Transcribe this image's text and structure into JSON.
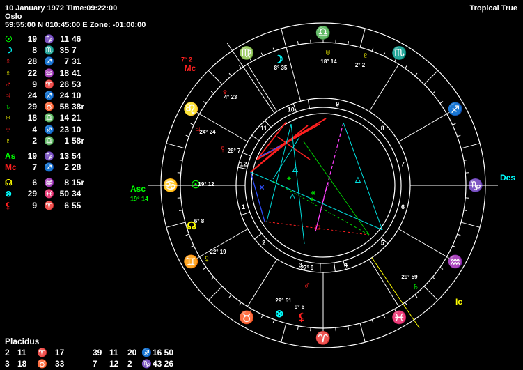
{
  "header": {
    "date_time": "10 January 1972 Time:09:22:00",
    "place": "Oslo",
    "coords": "59:55:00 N 010:45:00 E Zone: -01:00:00",
    "mode": "Tropical True"
  },
  "colors": {
    "fire": "#ff2020",
    "earth": "#00ff00",
    "air": "#ffff00",
    "water": "#00ffff",
    "white": "#ffffff",
    "blue": "#3050ff",
    "magenta": "#ff40ff",
    "cyan": "#00e0e0",
    "green": "#00d000"
  },
  "planets": [
    {
      "name": "Sun",
      "glyph": "☉",
      "color": "#00ff00",
      "deg": "19",
      "sign": "♑",
      "sign_color": "#00ff00",
      "min": "11",
      "sec": "46"
    },
    {
      "name": "Moon",
      "glyph": "☽",
      "color": "#00ffff",
      "deg": "8",
      "sign": "♏",
      "sign_color": "#00ffff",
      "min": "35",
      "sec": "7"
    },
    {
      "name": "Mercury",
      "glyph": "☿",
      "color": "#ff2020",
      "deg": "28",
      "sign": "♐",
      "sign_color": "#ff2020",
      "min": "7",
      "sec": "31"
    },
    {
      "name": "Venus",
      "glyph": "♀",
      "color": "#ffff00",
      "deg": "22",
      "sign": "♒",
      "sign_color": "#ffff00",
      "min": "18",
      "sec": "41"
    },
    {
      "name": "Mars",
      "glyph": "♂",
      "color": "#ff2020",
      "deg": "9",
      "sign": "♈",
      "sign_color": "#ff2020",
      "min": "26",
      "sec": "53"
    },
    {
      "name": "Jupiter",
      "glyph": "♃",
      "color": "#ff2020",
      "deg": "24",
      "sign": "♐",
      "sign_color": "#ff2020",
      "min": "24",
      "sec": "10"
    },
    {
      "name": "Saturn",
      "glyph": "♄",
      "color": "#00ff00",
      "deg": "29",
      "sign": "♉",
      "sign_color": "#00ff00",
      "min": "58",
      "sec": "38r"
    },
    {
      "name": "Uranus",
      "glyph": "♅",
      "color": "#ffff00",
      "deg": "18",
      "sign": "♎",
      "sign_color": "#ffff00",
      "min": "14",
      "sec": "21"
    },
    {
      "name": "Neptune",
      "glyph": "♆",
      "color": "#ff2020",
      "deg": "4",
      "sign": "♐",
      "sign_color": "#ff2020",
      "min": "23",
      "sec": "10"
    },
    {
      "name": "Pluto",
      "glyph": "♇",
      "color": "#ffff00",
      "deg": "2",
      "sign": "♎",
      "sign_color": "#ffff00",
      "min": "1",
      "sec": "58r"
    }
  ],
  "angles": [
    {
      "name": "As",
      "glyph": "As",
      "color": "#00ff00",
      "deg": "19",
      "sign": "♑",
      "sign_color": "#00ff00",
      "min": "13",
      "sec": "54"
    },
    {
      "name": "Mc",
      "glyph": "Mc",
      "color": "#ff2020",
      "deg": "7",
      "sign": "♐",
      "sign_color": "#ff2020",
      "min": "2",
      "sec": "28"
    }
  ],
  "points": [
    {
      "name": "Node",
      "glyph": "☊",
      "color": "#ffff00",
      "deg": "6",
      "sign": "♒",
      "sign_color": "#ffff00",
      "min": "8",
      "sec": "15r"
    },
    {
      "name": "Fortune",
      "glyph": "⊗",
      "color": "#00ffff",
      "deg": "29",
      "sign": "♓",
      "sign_color": "#00ffff",
      "min": "50",
      "sec": "34"
    },
    {
      "name": "Lilith",
      "glyph": "⚸",
      "color": "#ff2020",
      "deg": "9",
      "sign": "♈",
      "sign_color": "#ff2020",
      "min": "6",
      "sec": "55"
    }
  ],
  "house_system": "Placidus",
  "house_cusps": [
    [
      {
        "house": "2",
        "deg": "11",
        "sign": "♈",
        "sign_color": "#ff2020",
        "min": "17"
      },
      {
        "house": "3",
        "deg": "18",
        "sign": "♉",
        "sign_color": "#00ff00",
        "min": "33"
      }
    ],
    [
      {
        "house": "",
        "deg": "39",
        "sign": "",
        "sign_color": "#ffffff",
        "min": "11"
      },
      {
        "house": "",
        "deg": "7",
        "sign": "",
        "sign_color": "#ffffff",
        "min": "12"
      }
    ],
    [
      {
        "house": "",
        "deg": "20",
        "sign": "♐",
        "sign_color": "#ff2020",
        "min": "16 50"
      },
      {
        "house": "",
        "deg": "2",
        "sign": "♑",
        "sign_color": "#00ff00",
        "min": "43 26"
      }
    ]
  ],
  "wheel": {
    "zodiac_signs": [
      {
        "sign": "♎",
        "color": "#ffff00"
      },
      {
        "sign": "♏",
        "color": "#00ffff"
      },
      {
        "sign": "♐",
        "color": "#ff2020"
      },
      {
        "sign": "♑",
        "color": "#00ff00"
      },
      {
        "sign": "♒",
        "color": "#ffff00"
      },
      {
        "sign": "♓",
        "color": "#00ffff"
      },
      {
        "sign": "♈",
        "color": "#ff2020"
      },
      {
        "sign": "♉",
        "color": "#00ff00"
      },
      {
        "sign": "♊",
        "color": "#ffff00"
      },
      {
        "sign": "♋",
        "color": "#00ffff"
      },
      {
        "sign": "♌",
        "color": "#ff2020"
      },
      {
        "sign": "♍",
        "color": "#00ff00"
      }
    ],
    "angle_labels": {
      "asc": "Asc",
      "asc_deg": "19° 14",
      "des": "Des",
      "mc": "Mc",
      "mc_deg": "7° 2",
      "ic": "Ic"
    },
    "house_numbers": [
      "1",
      "2",
      "3",
      "4",
      "5",
      "6",
      "7",
      "8",
      "9",
      "10",
      "11",
      "12"
    ],
    "chart_planets": [
      {
        "glyph": "☽",
        "color": "#00ffff",
        "label": "8° 35"
      },
      {
        "glyph": "♅",
        "color": "#ffff00",
        "label": "18° 14"
      },
      {
        "glyph": "♇",
        "color": "#ffff00",
        "label": "2° 2"
      },
      {
        "glyph": "♆",
        "color": "#ff2020",
        "label": "4° 23"
      },
      {
        "glyph": "♃",
        "color": "#ff2020",
        "label": "24° 24"
      },
      {
        "glyph": "☿",
        "color": "#ff2020",
        "label": "28° 7"
      },
      {
        "glyph": "☉",
        "color": "#00ff00",
        "label": "19° 12"
      },
      {
        "glyph": "☊",
        "color": "#ffff00",
        "label": "6° 8"
      },
      {
        "glyph": "♀",
        "color": "#ffff00",
        "label": "22° 19"
      },
      {
        "glyph": "♂",
        "color": "#ff2020",
        "label": "27° 9"
      },
      {
        "glyph": "⊗",
        "color": "#00ffff",
        "label": "29° 51"
      },
      {
        "glyph": "⚸",
        "color": "#ff2020",
        "label": "9° 6"
      },
      {
        "glyph": "♄",
        "color": "#00ff00",
        "label": "29° 59"
      }
    ]
  }
}
